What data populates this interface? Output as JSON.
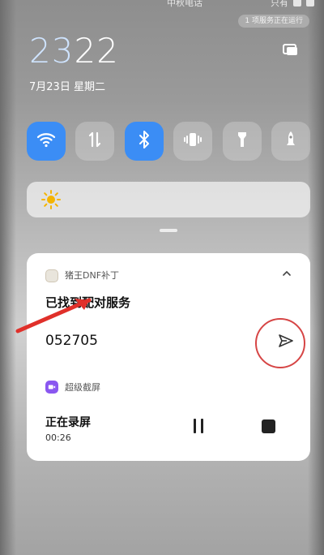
{
  "status_bar": {
    "carrier_text": "中秋电话",
    "right_text": "只有"
  },
  "service_chip": {
    "label": "1 项服务正在运行"
  },
  "clock": {
    "hours": "23",
    "minutes": "22",
    "date": "7月23日 星期二"
  },
  "quick_settings": [
    {
      "name": "wifi",
      "icon": "wifi-icon",
      "active": true
    },
    {
      "name": "mobile-data",
      "icon": "data-arrows-icon",
      "active": false
    },
    {
      "name": "bluetooth",
      "icon": "bluetooth-icon",
      "active": true
    },
    {
      "name": "vibrate",
      "icon": "vibrate-icon",
      "active": false
    },
    {
      "name": "flashlight",
      "icon": "flashlight-icon",
      "active": false
    },
    {
      "name": "airplane",
      "icon": "airplane-icon",
      "active": false
    }
  ],
  "brightness": {
    "icon": "sun-icon"
  },
  "notification": {
    "app_name": "猪王DNF补丁",
    "title": "已找到配对服务",
    "code": "052705",
    "send_icon": "send-icon",
    "collapse_icon": "chevron-up-icon"
  },
  "recording": {
    "app_name": "超级截屏",
    "title": "正在录屏",
    "time": "00:26",
    "pause_icon": "pause-icon",
    "stop_icon": "stop-icon"
  },
  "annotation": {
    "color": "#e0302a",
    "circle_color": "#d64545"
  },
  "colors": {
    "accent": "#3b8df5",
    "record_app": "#8a57f0"
  }
}
